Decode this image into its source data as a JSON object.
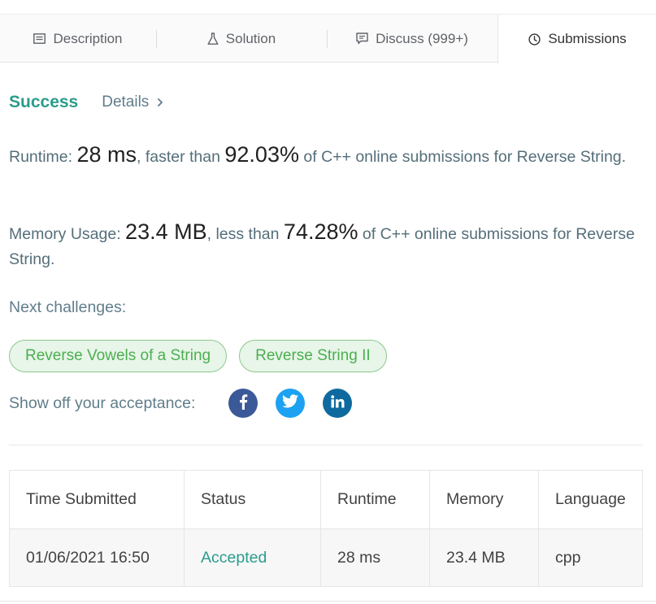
{
  "tabs": [
    {
      "label": "Description",
      "icon": "description-icon",
      "active": false
    },
    {
      "label": "Solution",
      "icon": "flask-icon",
      "active": false
    },
    {
      "label": "Discuss (999+)",
      "icon": "comment-icon",
      "active": false
    },
    {
      "label": "Submissions",
      "icon": "clock-icon",
      "active": true
    }
  ],
  "result": {
    "status": "Success",
    "details_label": "Details"
  },
  "runtime": {
    "label": "Runtime: ",
    "value": "28 ms",
    "mid": ", faster than ",
    "percent": "92.03%",
    "tail": " of C++ online submissions for Reverse String."
  },
  "memory": {
    "label": "Memory Usage: ",
    "value": "23.4 MB",
    "mid": ", less than ",
    "percent": "74.28%",
    "tail": " of C++ online submissions for Reverse String."
  },
  "next": {
    "label": "Next challenges:",
    "items": [
      "Reverse Vowels of a String",
      "Reverse String II"
    ]
  },
  "share": {
    "label": "Show off your acceptance:"
  },
  "colors": {
    "accent": "#2c9c8c",
    "chip_text": "#4caf50",
    "facebook": "#3b5998",
    "twitter": "#1da1f2",
    "linkedin": "#0e6a9e"
  },
  "table": {
    "headers": [
      "Time Submitted",
      "Status",
      "Runtime",
      "Memory",
      "Language"
    ],
    "rows": [
      [
        "01/06/2021 16:50",
        "Accepted",
        "28 ms",
        "23.4 MB",
        "cpp"
      ]
    ]
  }
}
